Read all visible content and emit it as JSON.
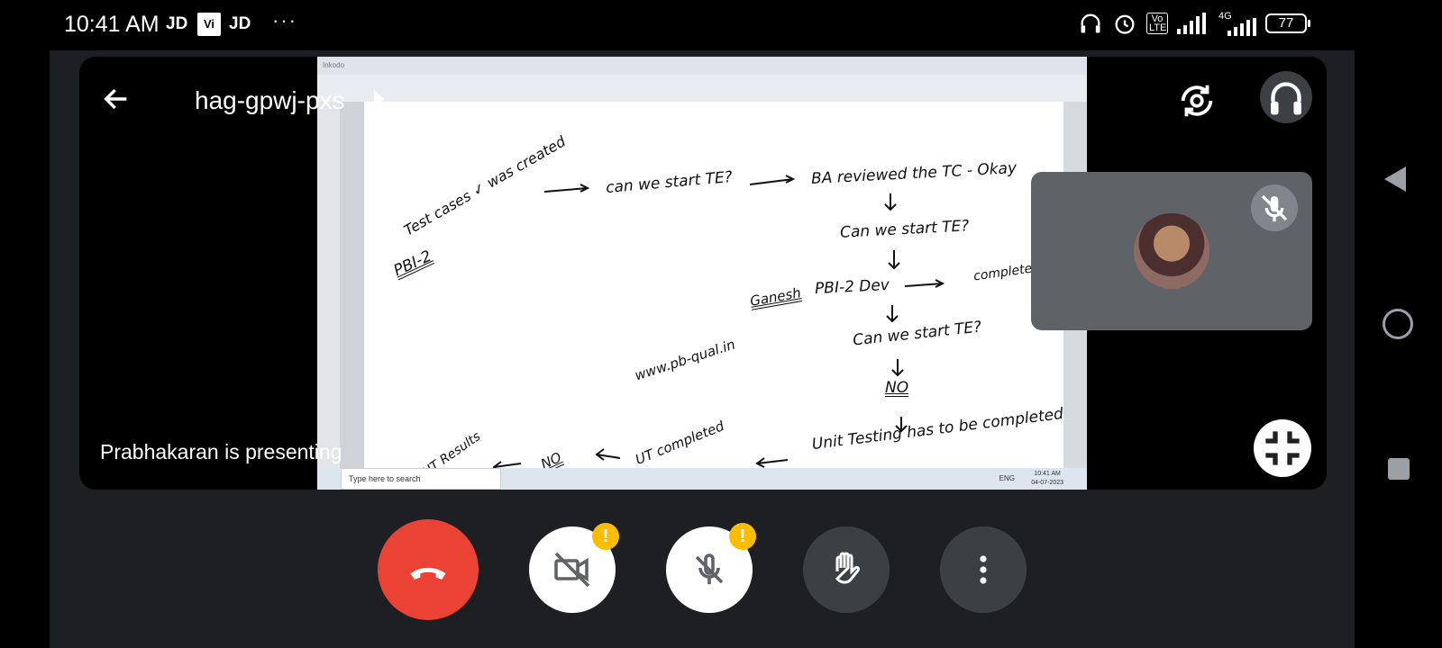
{
  "status_bar": {
    "time": "10:41 AM",
    "carrier_1": "JD",
    "carrier_icon": "Vi",
    "carrier_2": "JD",
    "more": "···",
    "network": "4G",
    "volte": "Vo LTE",
    "battery": "77"
  },
  "meeting": {
    "code": "hag-gpwj-pxs",
    "presenting_text": "Prabhakaran is presenting"
  },
  "presentation": {
    "app_title": "Inkodo",
    "taskbar_search": "Type here to search",
    "taskbar_lang": "ENG",
    "taskbar_time": "10:41 AM",
    "taskbar_date": "04-07-2023",
    "whiteboard": [
      {
        "id": "wb-1",
        "text": "Test cases ✓ was created"
      },
      {
        "id": "wb-2",
        "text": "can we start TE?"
      },
      {
        "id": "wb-3",
        "text": "BA reviewed the TC - Okay"
      },
      {
        "id": "wb-4",
        "text": "PBI-2"
      },
      {
        "id": "wb-5",
        "text": "Can we start TE?"
      },
      {
        "id": "wb-6",
        "text": "Ganesh"
      },
      {
        "id": "wb-7",
        "text": "PBI-2 Dev"
      },
      {
        "id": "wb-8",
        "text": "complete"
      },
      {
        "id": "wb-9",
        "text": "www.pb-qual.in"
      },
      {
        "id": "wb-10",
        "text": "Can we start TE?"
      },
      {
        "id": "wb-11",
        "text": "NO"
      },
      {
        "id": "wb-12",
        "text": "UT Results"
      },
      {
        "id": "wb-13",
        "text": "NO"
      },
      {
        "id": "wb-14",
        "text": "UT completed"
      },
      {
        "id": "wb-15",
        "text": "Unit Testing has to be completed"
      }
    ]
  },
  "controls": {
    "end_call": "end-call",
    "camera": "camera-off",
    "mic": "mic-off",
    "hand": "raise-hand",
    "more": "more-options",
    "warning_badge": "!"
  },
  "colors": {
    "end_call": "#ea4335",
    "warning": "#fbbc04",
    "control_dark": "#3c4043",
    "pip_bg": "#5f6368"
  }
}
